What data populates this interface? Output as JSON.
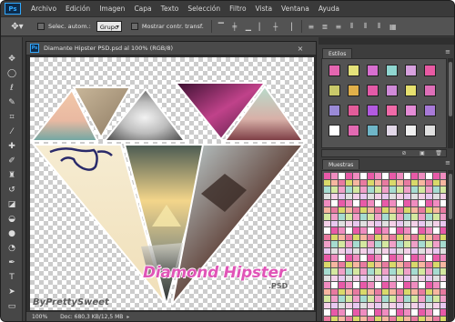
{
  "app": {
    "logo_text": "Ps",
    "menu": [
      "Archivo",
      "Edición",
      "Imagen",
      "Capa",
      "Texto",
      "Selección",
      "Filtro",
      "Vista",
      "Ventana",
      "Ayuda"
    ]
  },
  "options_bar": {
    "auto_select_label": "Selec. autom.:",
    "auto_select_value": "Grupo",
    "show_transform_label": "Mostrar contr. transf."
  },
  "document": {
    "tab_icon_text": "Ps",
    "title": "Diamante Hipster PSD.psd al 100% (RGB/8)",
    "close_glyph": "×",
    "zoom": "100%",
    "doc_size": "Doc: 680,3 KB/12,5 MB",
    "artwork": {
      "title": "Diamond Hipster",
      "subtitle": ".PSD",
      "credit": "ByPrettySweet"
    }
  },
  "panels": {
    "styles_tab": "Estilos",
    "swatches_tab": "Muestras",
    "menu_glyph": "≡"
  },
  "colors": {
    "accent_pink": "#e055b7",
    "ps_blue": "#31a8ff",
    "panel_bg": "#535353"
  },
  "icons": {
    "toolbox": [
      "move-icon",
      "marquee-icon",
      "lasso-icon",
      "quick-select-icon",
      "crop-icon",
      "eyedropper-icon",
      "healing-brush-icon",
      "brush-icon",
      "clone-stamp-icon",
      "history-brush-icon",
      "eraser-icon",
      "paint-bucket-icon",
      "blur-icon",
      "dodge-icon",
      "pen-icon",
      "type-icon",
      "path-select-icon",
      "rectangle-icon"
    ]
  }
}
